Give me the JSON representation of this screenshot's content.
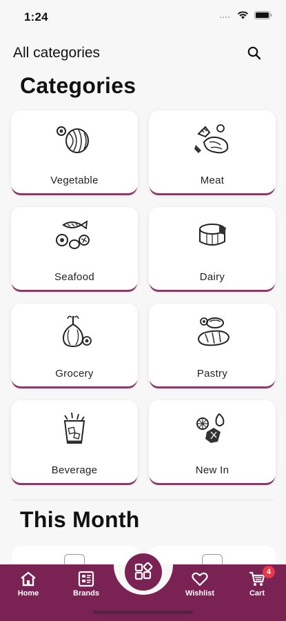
{
  "status_bar": {
    "time": "1:24"
  },
  "header": {
    "title": "All categories"
  },
  "categories_section": {
    "title": "Categories"
  },
  "categories": [
    {
      "label": "Vegetable",
      "icon": "vegetable-icon"
    },
    {
      "label": "Meat",
      "icon": "meat-icon"
    },
    {
      "label": "Seafood",
      "icon": "seafood-icon"
    },
    {
      "label": "Dairy",
      "icon": "dairy-icon"
    },
    {
      "label": "Grocery",
      "icon": "grocery-icon"
    },
    {
      "label": "Pastry",
      "icon": "pastry-icon"
    },
    {
      "label": "Beverage",
      "icon": "beverage-icon"
    },
    {
      "label": "New In",
      "icon": "new-in-icon"
    }
  ],
  "month_section": {
    "title": "This Month"
  },
  "bottom_nav": {
    "home": "Home",
    "brands": "Brands",
    "wishlist": "Wishlist",
    "cart": "Cart",
    "cart_count": "4"
  },
  "colors": {
    "brand": "#7b2255",
    "badge": "#e6394a",
    "card_shadow": "#8a3a66"
  }
}
